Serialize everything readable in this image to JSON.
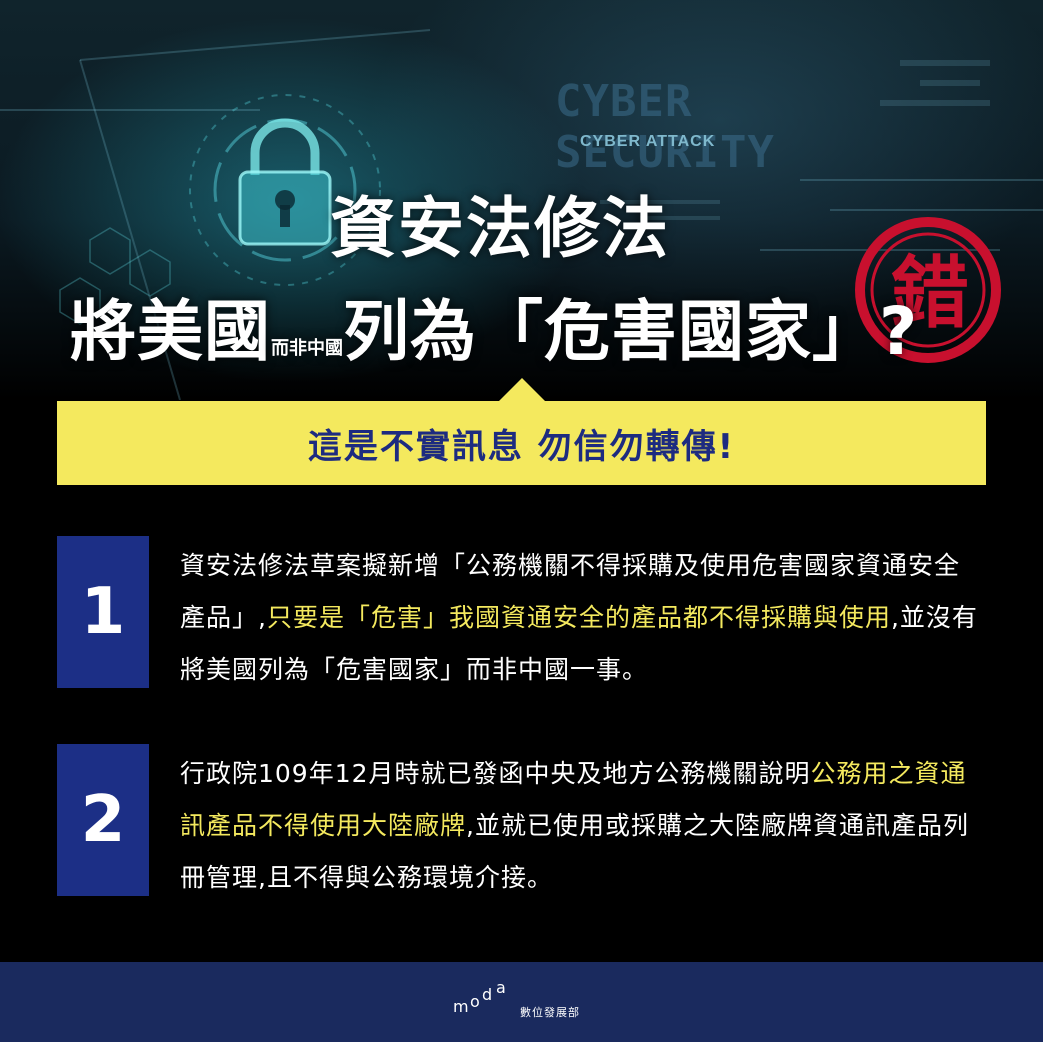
{
  "hero": {
    "bg_text_1": "CYBER SECURITY",
    "bg_text_2": "CYBER ATTACK",
    "icon": "padlock-icon"
  },
  "headline": {
    "line1": "資安法修法",
    "line2_a": "將美國",
    "line2_small": "而非中國",
    "line2_b": "列為「危害國家」?",
    "stamp": "錯"
  },
  "callout": {
    "text": "這是不實訊息 勿信勿轉傳!"
  },
  "items": [
    {
      "number": "1",
      "part1": "資安法修法草案擬新增「公務機關不得採購及使用危害國家資通安全產品」,",
      "highlight": "只要是「危害」我國資通安全的產品都不得採購與使用",
      "part2": ",並沒有將美國列為「危害國家」而非中國一事。"
    },
    {
      "number": "2",
      "part1": "行政院109年12月時就已發函中央及地方公務機關說明",
      "highlight": "公務用之資通訊產品不得使用大陸廠牌",
      "part2": ",並就已使用或採購之大陸廠牌資通訊產品列冊管理,且不得與公務環境介接。"
    }
  ],
  "footer": {
    "logo": "moda",
    "org_name": "數位發展部"
  },
  "colors": {
    "accent_yellow": "#f4e95e",
    "navy": "#1c2f86",
    "footer_navy": "#1a2a5e",
    "stamp_red": "#c8102e"
  }
}
